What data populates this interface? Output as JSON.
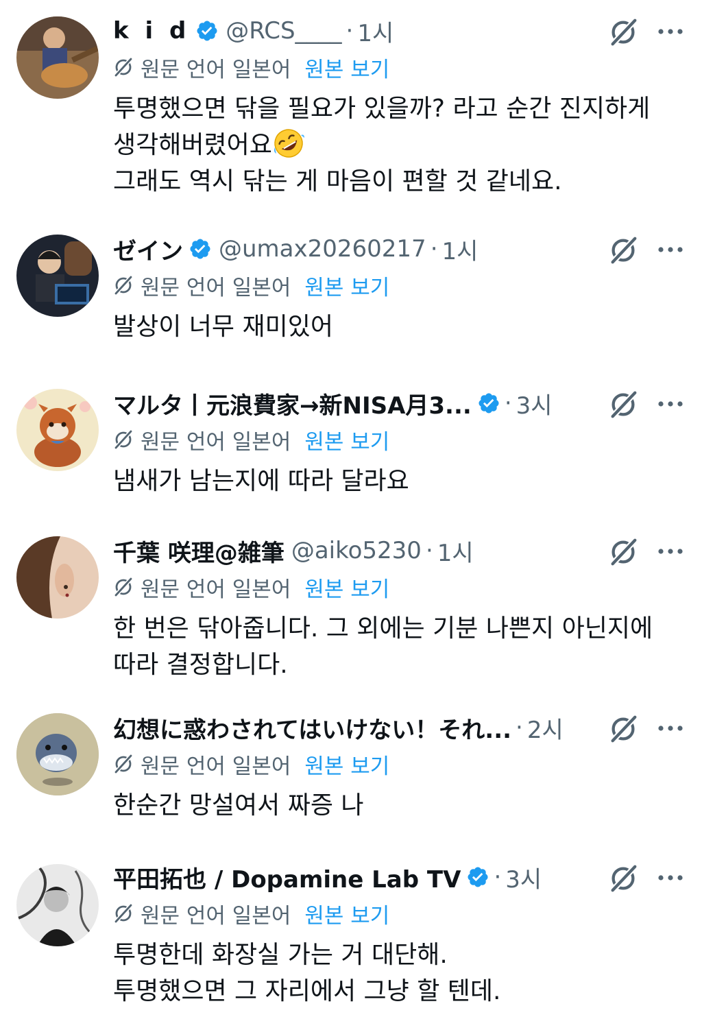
{
  "colors": {
    "text": "#0f1419",
    "secondary": "#536471",
    "link": "#1d9bf0",
    "verified": "#1d9bf0"
  },
  "icons": {
    "verified": "verified-badge-icon",
    "grok": "grok-icon",
    "more": "more-icon",
    "translate": "translate-icon",
    "emoji": "rofl-emoji-icon"
  },
  "posts": [
    {
      "name": "k i d",
      "verified": true,
      "handle": "@RCS____",
      "dot": "·",
      "time": "1시",
      "translate_label": "원문 언어 일본어",
      "translate_link": "원본 보기",
      "lines": [
        "투명했으면 닦을 필요가 있을까? 라고 순간 진지하게",
        "생각해버렸어요",
        "그래도 역시 닦는 게 마음이 편할 것 같네요."
      ]
    },
    {
      "name": "ゼイン",
      "verified": true,
      "handle": "@umax20260217",
      "dot": "·",
      "time": "1시",
      "translate_label": "원문 언어 일본어",
      "translate_link": "원본 보기",
      "lines": [
        "발상이 너무 재미있어"
      ]
    },
    {
      "name": "マルタ丨元浪費家→新NISA月3...",
      "verified": true,
      "handle": "",
      "dot": "·",
      "time": "3시",
      "translate_label": "원문 언어 일본어",
      "translate_link": "원본 보기",
      "lines": [
        "냄새가 남는지에 따라 달라요"
      ]
    },
    {
      "name": "千葉 咲理@雑筆",
      "verified": false,
      "handle": "@aiko5230",
      "dot": "·",
      "time": "1시",
      "translate_label": "원문 언어 일본어",
      "translate_link": "원본 보기",
      "lines": [
        "한 번은 닦아줍니다. 그 외에는 기분 나쁜지 아닌지에",
        "따라 결정합니다."
      ]
    },
    {
      "name": "幻想に惑わされてはいけない！それ...",
      "verified": false,
      "handle": "",
      "dot": "·",
      "time": "2시",
      "translate_label": "원문 언어 일본어",
      "translate_link": "원본 보기",
      "lines": [
        "한순간 망설여서 짜증 나"
      ]
    },
    {
      "name": "平田拓也 / Dopamine Lab TV",
      "verified": true,
      "handle": "",
      "dot": "·",
      "time": "3시",
      "translate_label": "원문 언어 일본어",
      "translate_link": "원본 보기",
      "lines": [
        "투명한데 화장실 가는 거 대단해.",
        "투명했으면 그 자리에서 그냥 할 텐데."
      ]
    }
  ]
}
